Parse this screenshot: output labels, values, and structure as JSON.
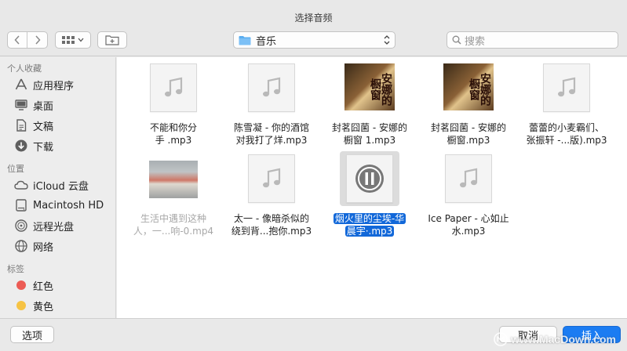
{
  "window": {
    "title": "选择音频"
  },
  "toolbar": {
    "location": "音乐",
    "search_placeholder": "搜索"
  },
  "sidebar": {
    "sections": [
      {
        "title": "个人收藏",
        "items": [
          {
            "label": "应用程序",
            "icon": "applications-icon"
          },
          {
            "label": "桌面",
            "icon": "desktop-icon"
          },
          {
            "label": "文稿",
            "icon": "documents-icon"
          },
          {
            "label": "下载",
            "icon": "downloads-icon"
          }
        ]
      },
      {
        "title": "位置",
        "items": [
          {
            "label": "iCloud 云盘",
            "icon": "icloud-icon"
          },
          {
            "label": "Macintosh HD",
            "icon": "harddisk-icon"
          },
          {
            "label": "远程光盘",
            "icon": "disc-icon"
          },
          {
            "label": "网络",
            "icon": "network-icon"
          }
        ]
      },
      {
        "title": "标签",
        "items": [
          {
            "label": "红色",
            "color": "#ec5b54"
          },
          {
            "label": "黄色",
            "color": "#f6c344"
          }
        ]
      }
    ]
  },
  "files": [
    {
      "line1": "不能和你分",
      "line2": "手 .mp3",
      "type": "audio"
    },
    {
      "line1": "陈雪凝 - 你的酒馆",
      "line2": "对我打了烊.mp3",
      "type": "audio"
    },
    {
      "line1": "封茗囧菌 - 安娜的",
      "line2": "橱窗 1.mp3",
      "type": "album"
    },
    {
      "line1": "封茗囧菌 - 安娜的",
      "line2": "橱窗.mp3",
      "type": "album"
    },
    {
      "line1": "蕾蕾的小麦霸们、",
      "line2": "张振轩 -...版).mp3",
      "type": "audio"
    },
    {
      "line1": "生活中遇到这种",
      "line2": "人，一...响-0.mp4",
      "type": "video"
    },
    {
      "line1": "太一 - 像暗杀似的",
      "line2": "绕到背...抱你.mp3",
      "type": "audio"
    },
    {
      "line1": "烟火里的尘埃-华",
      "line2": "晨宇·.mp3",
      "type": "playing"
    },
    {
      "line1": "Ice Paper - 心如止",
      "line2": "水.mp3",
      "type": "audio"
    }
  ],
  "album_art_text": "安娜的橱窗",
  "buttons": {
    "options": "选项",
    "cancel": "取消",
    "insert": "插入"
  },
  "watermark": "www.MacDown.com",
  "colors": {
    "accent": "#1b7cf2",
    "selection": "#1268d9"
  }
}
